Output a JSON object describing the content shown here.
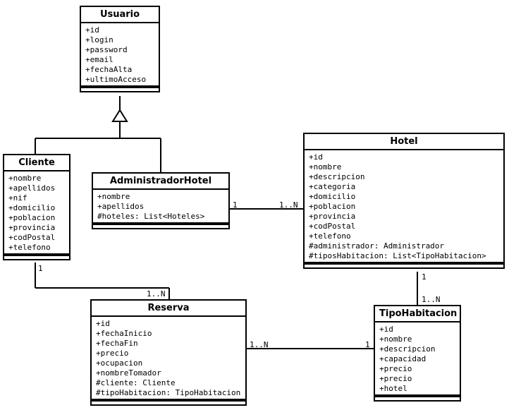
{
  "diagram_type": "UML Class Diagram",
  "classes": {
    "usuario": {
      "name": "Usuario",
      "attrs": [
        "+id",
        "+login",
        "+password",
        "+email",
        "+fechaAlta",
        "+ultimoAcceso"
      ]
    },
    "cliente": {
      "name": "Cliente",
      "attrs": [
        "+nombre",
        "+apellidos",
        "+nif",
        "+domicilio",
        "+poblacion",
        "+provincia",
        "+codPostal",
        "+telefono"
      ]
    },
    "adminHotel": {
      "name": "AdministradorHotel",
      "attrs": [
        "+nombre",
        "+apellidos",
        "#hoteles: List<Hoteles>"
      ]
    },
    "hotel": {
      "name": "Hotel",
      "attrs": [
        "+id",
        "+nombre",
        "+descripcion",
        "+categoria",
        "+domicilio",
        "+poblacion",
        "+provincia",
        "+codPostal",
        "+telefono",
        "#administrador: Administrador",
        "#tiposHabitacion: List<TipoHabitacion>"
      ]
    },
    "reserva": {
      "name": "Reserva",
      "attrs": [
        "+id",
        "+fechaInicio",
        "+fechaFin",
        "+precio",
        "+ocupacion",
        "+nombreTomador",
        "#cliente: Cliente",
        "#tipoHabitacion: TipoHabitacion"
      ]
    },
    "tipoHabitacion": {
      "name": "TipoHabitacion",
      "attrs": [
        "+id",
        "+nombre",
        "+descripcion",
        "+capacidad",
        "+precio",
        "+precio",
        "+hotel"
      ]
    }
  },
  "multiplicities": {
    "adminHotel_hotel_left": "1",
    "adminHotel_hotel_right": "1..N",
    "hotel_tipo_top": "1",
    "hotel_tipo_bottom": "1..N",
    "tipo_reserva_right": "1",
    "tipo_reserva_left": "1..N",
    "cliente_reserva_top": "1",
    "cliente_reserva_bottom": "1..N"
  },
  "relationships": [
    {
      "from": "Cliente",
      "to": "Usuario",
      "type": "generalization"
    },
    {
      "from": "AdministradorHotel",
      "to": "Usuario",
      "type": "generalization"
    },
    {
      "from": "AdministradorHotel",
      "to": "Hotel",
      "type": "association",
      "fromMult": "1",
      "toMult": "1..N"
    },
    {
      "from": "Hotel",
      "to": "TipoHabitacion",
      "type": "association",
      "fromMult": "1",
      "toMult": "1..N"
    },
    {
      "from": "TipoHabitacion",
      "to": "Reserva",
      "type": "association",
      "fromMult": "1",
      "toMult": "1..N"
    },
    {
      "from": "Cliente",
      "to": "Reserva",
      "type": "association",
      "fromMult": "1",
      "toMult": "1..N"
    }
  ]
}
